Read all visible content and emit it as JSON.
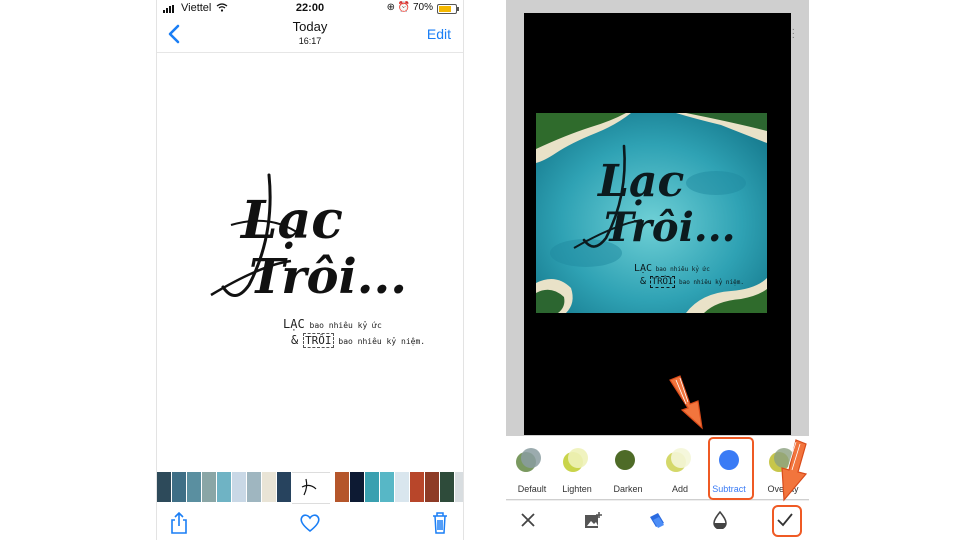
{
  "left_phone": {
    "status": {
      "carrier": "Viettel",
      "time": "22:00",
      "battery_percent": "70%"
    },
    "nav": {
      "back_icon": "chevron-left-icon",
      "title": "Today",
      "subtitle": "16:17",
      "edit_label": "Edit"
    },
    "artwork": {
      "title_line1": "Lạc",
      "title_line2": "Trôi...",
      "line1_word": "LẠC",
      "line1_rest": "bao nhiêu kỷ ức",
      "line2_amp": "&",
      "line2_word": "TRÔI",
      "line2_rest": "bao nhiêu kỷ niệm."
    },
    "toolbar": {
      "share_icon": "share-icon",
      "favorite_icon": "heart-icon",
      "delete_icon": "trash-icon"
    }
  },
  "right_phone": {
    "artwork": {
      "title_line1": "Lạc",
      "title_line2": "Trôi...",
      "line1_word": "LẠC",
      "line1_rest": "bao nhiêu kỷ ức",
      "line2_amp": "&",
      "line2_word": "TRÔI",
      "line2_rest": "bao nhiêu kỷ niệm."
    },
    "blend_modes": [
      {
        "label": "Default"
      },
      {
        "label": "Lighten"
      },
      {
        "label": "Darken"
      },
      {
        "label": "Add"
      },
      {
        "label": "Subtract"
      },
      {
        "label": "Overlay"
      }
    ],
    "selected_blend": "Subtract",
    "tools": {
      "cancel_icon": "close-icon",
      "add_image_icon": "add-photo-icon",
      "blend_icon": "layers-icon",
      "opacity_icon": "opacity-icon",
      "apply_icon": "check-icon"
    },
    "colors": {
      "accent": "#3a7bf5",
      "highlight": "#ef5a24"
    }
  }
}
